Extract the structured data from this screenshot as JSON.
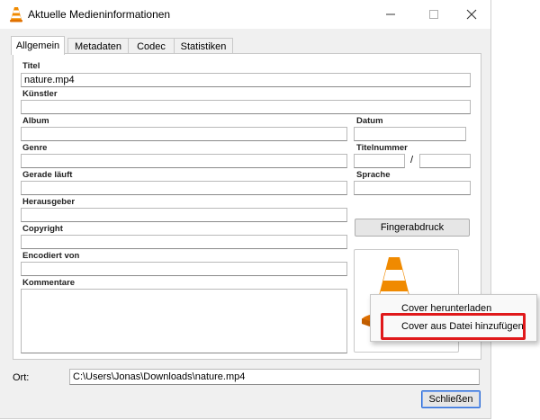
{
  "window": {
    "title": "Aktuelle Medieninformationen",
    "app_icon": "vlc-cone-icon",
    "controls": [
      "minimize-icon",
      "maximize-icon",
      "close-icon"
    ]
  },
  "tabs": [
    {
      "label": "Allgemein",
      "active": true
    },
    {
      "label": "Metadaten",
      "active": false
    },
    {
      "label": "Codec",
      "active": false
    },
    {
      "label": "Statistiken",
      "active": false
    }
  ],
  "fields": {
    "titel": {
      "label": "Titel",
      "value": "nature.mp4"
    },
    "kuenstler": {
      "label": "Künstler",
      "value": ""
    },
    "album": {
      "label": "Album",
      "value": ""
    },
    "datum": {
      "label": "Datum",
      "value": ""
    },
    "genre": {
      "label": "Genre",
      "value": ""
    },
    "titelnummer": {
      "label": "Titelnummer",
      "value": "",
      "separator": "/",
      "total": ""
    },
    "gerade_laeuft": {
      "label": "Gerade läuft",
      "value": ""
    },
    "sprache": {
      "label": "Sprache",
      "value": ""
    },
    "herausgeber": {
      "label": "Herausgeber",
      "value": ""
    },
    "copyright": {
      "label": "Copyright",
      "value": ""
    },
    "encodiert_von": {
      "label": "Encodiert von",
      "value": ""
    },
    "kommentare": {
      "label": "Kommentare",
      "value": ""
    }
  },
  "buttons": {
    "fingerabdruck": "Fingerabdruck",
    "schliessen": "Schließen"
  },
  "cover": {
    "icon": "vlc-cone-icon"
  },
  "context_menu": {
    "items": [
      "Cover herunterladen",
      "Cover aus Datei hinzufügen"
    ],
    "highlighted_index": 1,
    "highlight_color": "#e0191b"
  },
  "location": {
    "label": "Ort:",
    "value": "C:\\Users\\Jonas\\Downloads\\nature.mp4"
  }
}
